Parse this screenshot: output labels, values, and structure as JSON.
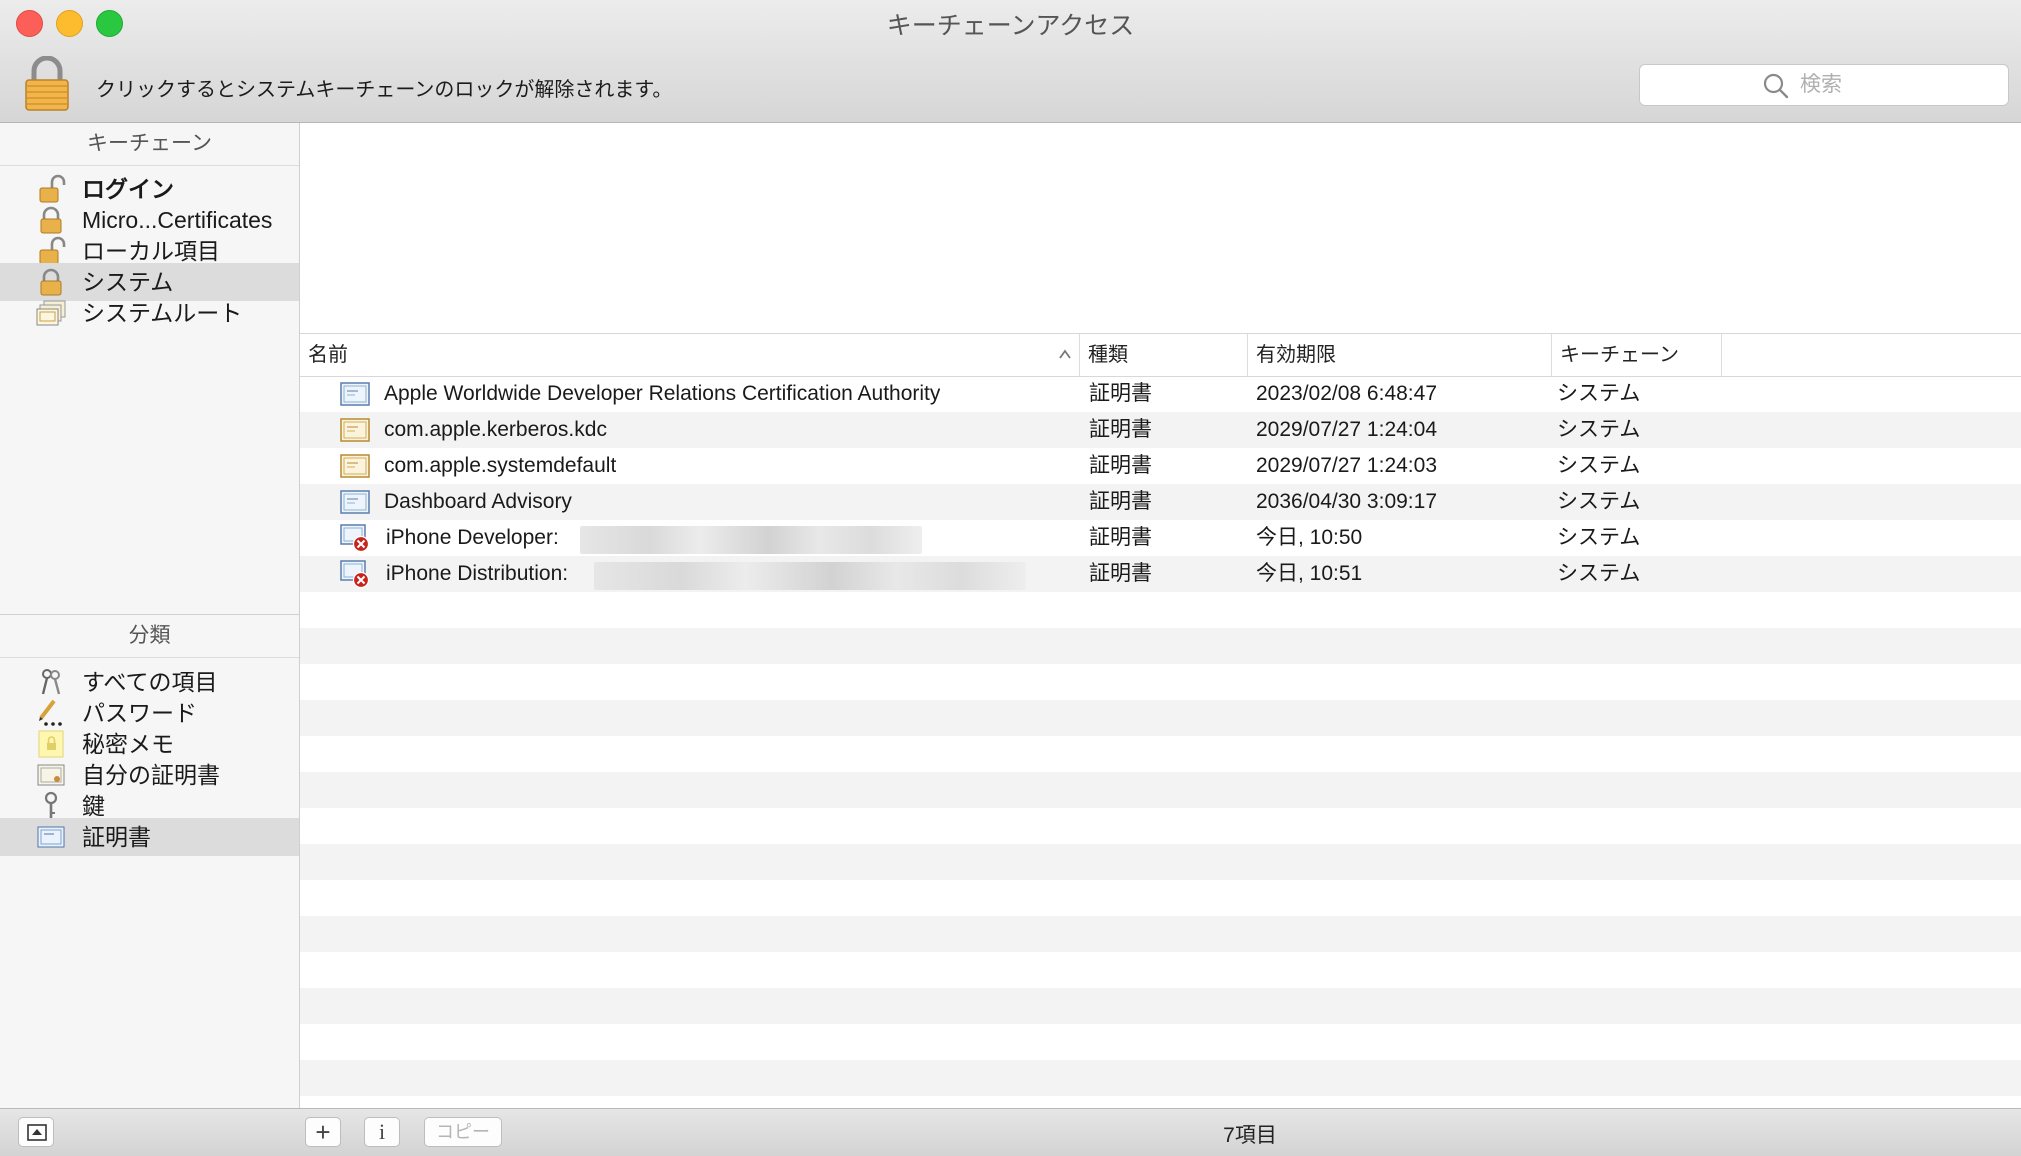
{
  "window": {
    "title": "キーチェーンアクセス"
  },
  "toolbar": {
    "lock_message": "クリックするとシステムキーチェーンのロックが解除されます。",
    "search_placeholder": "検索"
  },
  "sidebar": {
    "keychains_header": "キーチェーン",
    "keychains": [
      {
        "label": "ログイン",
        "icon": "unlocked-padlock-icon",
        "bold": true,
        "selected": false
      },
      {
        "label": "Micro...Certificates",
        "icon": "padlock-icon",
        "bold": false,
        "selected": false
      },
      {
        "label": "ローカル項目",
        "icon": "unlocked-padlock-icon",
        "bold": false,
        "selected": false
      },
      {
        "label": "システム",
        "icon": "padlock-icon",
        "bold": false,
        "selected": true
      },
      {
        "label": "システムルート",
        "icon": "certificate-stack-icon",
        "bold": false,
        "selected": false
      }
    ],
    "category_header": "分類",
    "categories": [
      {
        "label": "すべての項目",
        "icon": "keys-icon",
        "selected": false
      },
      {
        "label": "パスワード",
        "icon": "password-pencil-icon",
        "selected": false
      },
      {
        "label": "秘密メモ",
        "icon": "secure-note-icon",
        "selected": false
      },
      {
        "label": "自分の証明書",
        "icon": "my-certificate-icon",
        "selected": false
      },
      {
        "label": "鍵",
        "icon": "key-icon",
        "selected": false
      },
      {
        "label": "証明書",
        "icon": "certificate-icon",
        "selected": true
      }
    ]
  },
  "table": {
    "columns": [
      "名前",
      "種類",
      "有効期限",
      "キーチェーン"
    ],
    "rows": [
      {
        "name": "Apple Worldwide Developer Relations Certification Authority",
        "kind": "証明書",
        "expires": "2023/02/08 6:48:47",
        "keychain": "システム",
        "icon": "certificate-blue-icon",
        "invalid": false
      },
      {
        "name": "com.apple.kerberos.kdc",
        "kind": "証明書",
        "expires": "2029/07/27 1:24:04",
        "keychain": "システム",
        "icon": "certificate-gold-icon",
        "invalid": false
      },
      {
        "name": "com.apple.systemdefault",
        "kind": "証明書",
        "expires": "2029/07/27 1:24:03",
        "keychain": "システム",
        "icon": "certificate-gold-icon",
        "invalid": false
      },
      {
        "name": "Dashboard Advisory",
        "kind": "証明書",
        "expires": "2036/04/30 3:09:17",
        "keychain": "システム",
        "icon": "certificate-blue-icon",
        "invalid": false
      },
      {
        "name": "iPhone Developer:",
        "kind": "証明書",
        "expires": "今日, 10:50",
        "keychain": "システム",
        "icon": "certificate-invalid-icon",
        "invalid": true
      },
      {
        "name": "iPhone Distribution:",
        "kind": "証明書",
        "expires": "今日, 10:51",
        "keychain": "システム",
        "icon": "certificate-invalid-icon",
        "invalid": true
      }
    ]
  },
  "bottombar": {
    "add_label": "+",
    "info_label": "i",
    "copy_label": "コピー",
    "item_count": "7項目"
  },
  "colors": {
    "selection": "#dcdcdc",
    "close": "#fc5f57",
    "minimize": "#fdbc2e",
    "maximize": "#29c840",
    "invalid_badge": "#c9241c"
  }
}
